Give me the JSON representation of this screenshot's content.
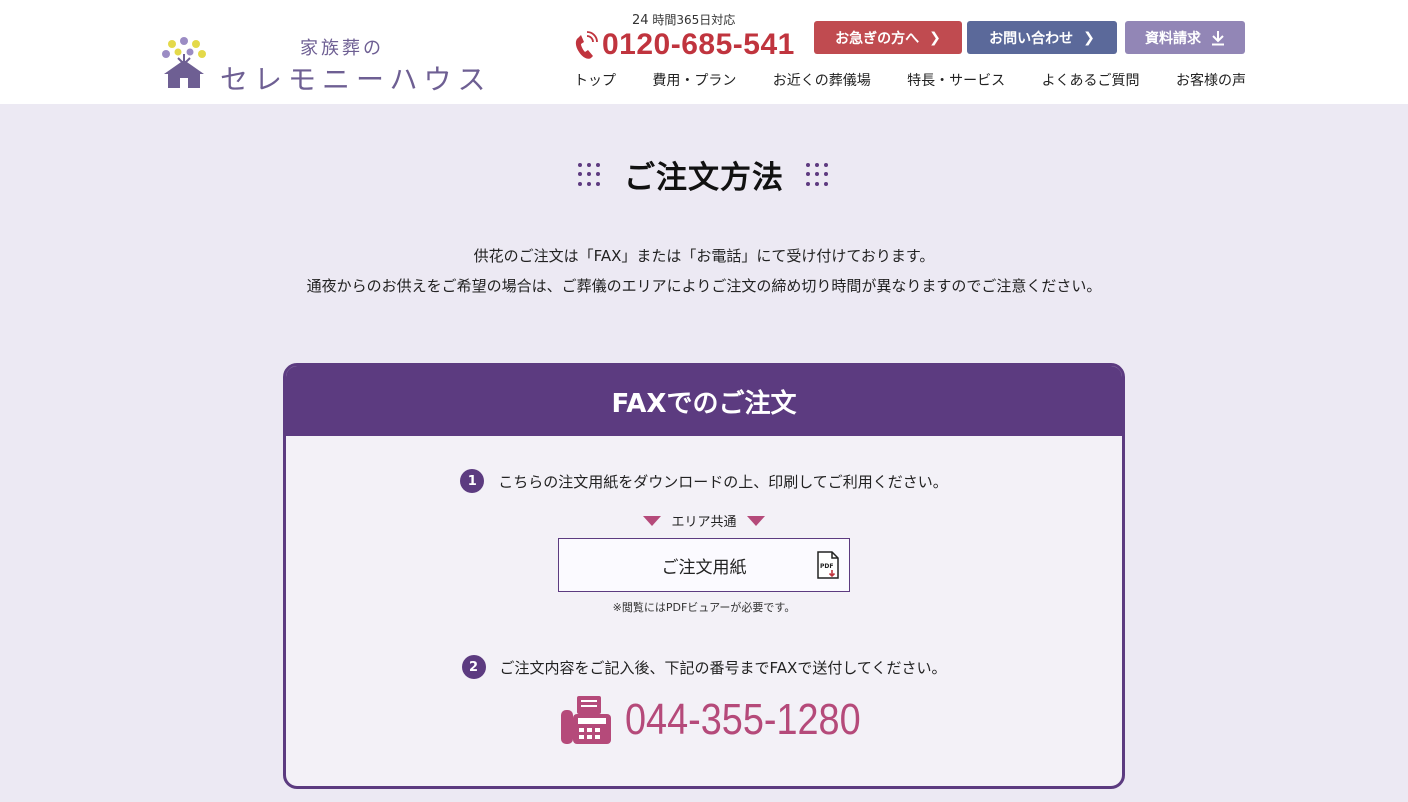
{
  "header": {
    "logo": {
      "subtitle": "家族葬の",
      "name": "セレモニーハウス",
      "icon": "tree-house-logo"
    },
    "hours": {
      "number": "24",
      "text": "時間365日対応"
    },
    "phone": {
      "icon": "phone-icon",
      "number": "0120-685-541"
    },
    "buttons": {
      "urgent": "お急ぎの方へ",
      "contact": "お問い合わせ",
      "docs": "資料請求"
    },
    "nav": [
      "トップ",
      "費用・プラン",
      "お近くの葬儀場",
      "特長・サービス",
      "よくあるご質問",
      "お客様の声"
    ]
  },
  "section": {
    "title": "ご注文方法",
    "intro": [
      "供花のご注文は「FAX」または「お電話」にて受け付けております。",
      "通夜からのお供えをご希望の場合は、ご葬儀のエリアによりご注文の締め切り時間が異なりますのでご注意ください。"
    ]
  },
  "fax_card": {
    "title": "FAXでのご注文",
    "step1": {
      "num": "1",
      "text": "こちらの注文用紙をダウンロードの上、印刷してご利用ください。"
    },
    "area_label": "エリア共通",
    "download_label": "ご注文用紙",
    "pdf_icon_text": "PDF",
    "note": "※閲覧にはPDFビュアーが必要です。",
    "step2": {
      "num": "2",
      "text": "ご注文内容をご記入後、下記の番号までFAXで送付してください。"
    },
    "fax_number": "044-355-1280"
  },
  "colors": {
    "brand_purple": "#5c3b80",
    "phone_red": "#c0343e",
    "fax_pink": "#b54a7a",
    "page_bg": "#ece9f3"
  }
}
